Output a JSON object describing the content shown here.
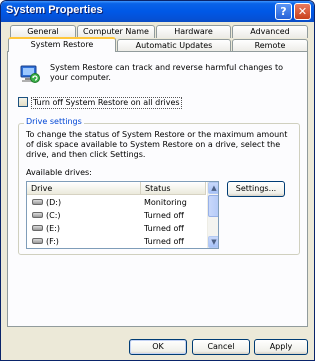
{
  "window": {
    "title": "System Properties",
    "help_button": "?",
    "close_button": "✕"
  },
  "tabs": {
    "row_back": [
      "General",
      "Computer Name",
      "Hardware",
      "Advanced"
    ],
    "row_front": [
      "System Restore",
      "Automatic Updates",
      "Remote"
    ],
    "active": "System Restore"
  },
  "info": {
    "text": "System Restore can track and reverse harmful changes to your computer."
  },
  "turn_off": {
    "label": "Turn off System Restore on all drives",
    "checked": false
  },
  "drive_settings": {
    "title": "Drive settings",
    "description": "To change the status of System Restore or the maximum amount of disk space available to System Restore on a drive, select the drive, and then click Settings.",
    "available_label": "Available drives:",
    "columns": [
      "Drive",
      "Status"
    ],
    "drives": [
      {
        "name": "(D:)",
        "status": "Monitoring"
      },
      {
        "name": "(C:)",
        "status": "Turned off"
      },
      {
        "name": "(E:)",
        "status": "Turned off"
      },
      {
        "name": "(F:)",
        "status": "Turned off"
      }
    ],
    "settings_button": "Settings..."
  },
  "footer": {
    "ok": "OK",
    "cancel": "Cancel",
    "apply": "Apply"
  },
  "colors": {
    "titlebar": "#0058E6",
    "dialog_bg": "#ECE9D8",
    "group_title": "#0046D5",
    "active_tab_accent": "#FFC73C"
  }
}
